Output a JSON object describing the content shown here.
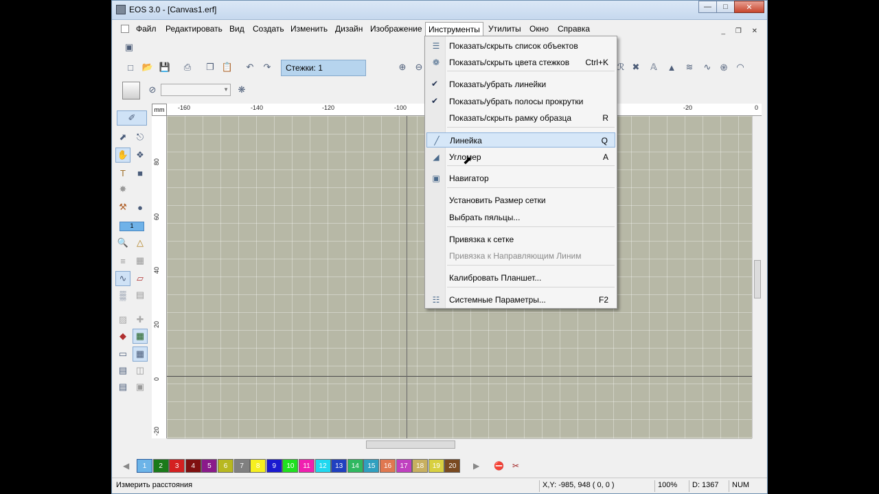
{
  "window": {
    "title": "EOS 3.0 - [Canvas1.erf]"
  },
  "menubar": {
    "items": [
      "Файл",
      "Редактировать",
      "Вид",
      "Создать",
      "Изменить",
      "Дизайн",
      "Изображение",
      "Инструменты",
      "Утилиты",
      "Окно",
      "Справка"
    ],
    "active": "Инструменты"
  },
  "toolbar": {
    "stitches_label": "Стежки: 1"
  },
  "toolbox": {
    "field_value": "1"
  },
  "ruler": {
    "unit": "mm",
    "x_ticks": [
      "-160",
      "-140",
      "-120",
      "-100",
      "-20",
      "0"
    ],
    "y_ticks": [
      "80",
      "60",
      "40",
      "20",
      "0",
      "-20"
    ]
  },
  "dropdown": {
    "items": [
      {
        "label": "Показать/скрыть список объектов",
        "shortcut": "",
        "icon": "object-list-icon",
        "checked": false,
        "disabled": false,
        "highlight": false
      },
      {
        "label": "Показать/скрыть цвета стежков",
        "shortcut": "Ctrl+K",
        "icon": "palette-icon",
        "checked": false,
        "disabled": false,
        "highlight": false
      },
      {
        "label": "Показать/убрать линейки",
        "shortcut": "",
        "icon": "",
        "checked": true,
        "disabled": false,
        "highlight": false
      },
      {
        "label": "Показать/убрать полосы прокрутки",
        "shortcut": "",
        "icon": "",
        "checked": true,
        "disabled": false,
        "highlight": false
      },
      {
        "label": "Показать/скрыть рамку образца",
        "shortcut": "R",
        "icon": "",
        "checked": false,
        "disabled": false,
        "highlight": false
      },
      {
        "label": "Линейка",
        "shortcut": "Q",
        "icon": "ruler-icon",
        "checked": false,
        "disabled": false,
        "highlight": true
      },
      {
        "label": "Угломер",
        "shortcut": "A",
        "icon": "protractor-icon",
        "checked": false,
        "disabled": false,
        "highlight": false
      },
      {
        "label": "Навигатор",
        "shortcut": "",
        "icon": "navigator-icon",
        "checked": false,
        "disabled": false,
        "highlight": false
      },
      {
        "label": "Установить Размер сетки",
        "shortcut": "",
        "icon": "",
        "checked": false,
        "disabled": false,
        "highlight": false
      },
      {
        "label": "Выбрать пяльцы...",
        "shortcut": "",
        "icon": "",
        "checked": false,
        "disabled": false,
        "highlight": false
      },
      {
        "label": "Привязка к сетке",
        "shortcut": "",
        "icon": "",
        "checked": false,
        "disabled": false,
        "highlight": false
      },
      {
        "label": "Привязка к Направляющим Линим",
        "shortcut": "",
        "icon": "",
        "checked": false,
        "disabled": true,
        "highlight": false
      },
      {
        "label": "Калибровать Планшет...",
        "shortcut": "",
        "icon": "",
        "checked": false,
        "disabled": false,
        "highlight": false
      },
      {
        "label": "Системные Параметры...",
        "shortcut": "F2",
        "icon": "settings-icon",
        "checked": false,
        "disabled": false,
        "highlight": false
      }
    ]
  },
  "palette": {
    "chips": [
      {
        "n": "1",
        "color": "#6cb4e8"
      },
      {
        "n": "2",
        "color": "#1a7a1a"
      },
      {
        "n": "3",
        "color": "#d42020"
      },
      {
        "n": "4",
        "color": "#801010"
      },
      {
        "n": "5",
        "color": "#8a1a8a"
      },
      {
        "n": "6",
        "color": "#b8b820"
      },
      {
        "n": "7",
        "color": "#808080"
      },
      {
        "n": "8",
        "color": "#f6f020"
      },
      {
        "n": "9",
        "color": "#1a1ad0"
      },
      {
        "n": "10",
        "color": "#20e020"
      },
      {
        "n": "11",
        "color": "#f020b0"
      },
      {
        "n": "12",
        "color": "#20d8f0"
      },
      {
        "n": "13",
        "color": "#2040c0"
      },
      {
        "n": "14",
        "color": "#30b860"
      },
      {
        "n": "15",
        "color": "#30a0c0"
      },
      {
        "n": "16",
        "color": "#e07850"
      },
      {
        "n": "17",
        "color": "#c040c0"
      },
      {
        "n": "18",
        "color": "#c8b060"
      },
      {
        "n": "19",
        "color": "#d8d040"
      },
      {
        "n": "20",
        "color": "#7a4a20"
      }
    ]
  },
  "status": {
    "message": "Измерить расстояния",
    "coords": "X,Y: -985, 948  ( 0, 0 )",
    "zoom": "100%",
    "distance": "D: 1367",
    "num": "NUM"
  }
}
